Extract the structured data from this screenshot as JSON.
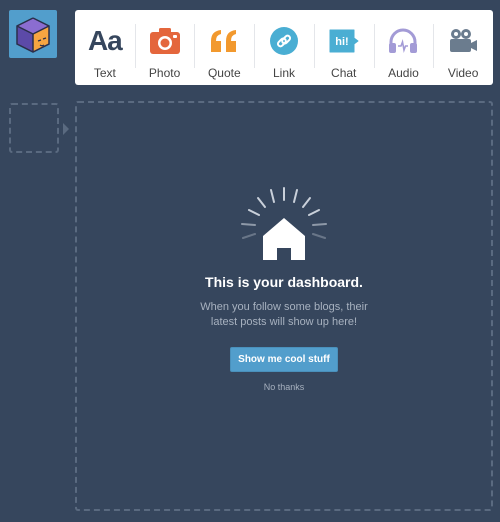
{
  "post_types": [
    {
      "id": "text",
      "label": "Text",
      "glyph": "Aa",
      "color": "#36465d"
    },
    {
      "id": "photo",
      "label": "Photo",
      "color": "#ff492f"
    },
    {
      "id": "quote",
      "label": "Quote",
      "glyph": "“",
      "color": "#ff8a00"
    },
    {
      "id": "link",
      "label": "Link",
      "color": "#00cf35"
    },
    {
      "id": "chat",
      "label": "Chat",
      "glyph": "hi!",
      "color": "#00b8ff"
    },
    {
      "id": "audio",
      "label": "Audio",
      "color": "#7c5cff"
    },
    {
      "id": "video",
      "label": "Video",
      "color": "#ff62ce"
    }
  ],
  "dashboard": {
    "title": "This is your dashboard.",
    "subtitle_line1": "When you follow some blogs, their",
    "subtitle_line2": "latest posts will show up here!",
    "cta": "Show me cool stuff",
    "dismiss": "No thanks"
  }
}
